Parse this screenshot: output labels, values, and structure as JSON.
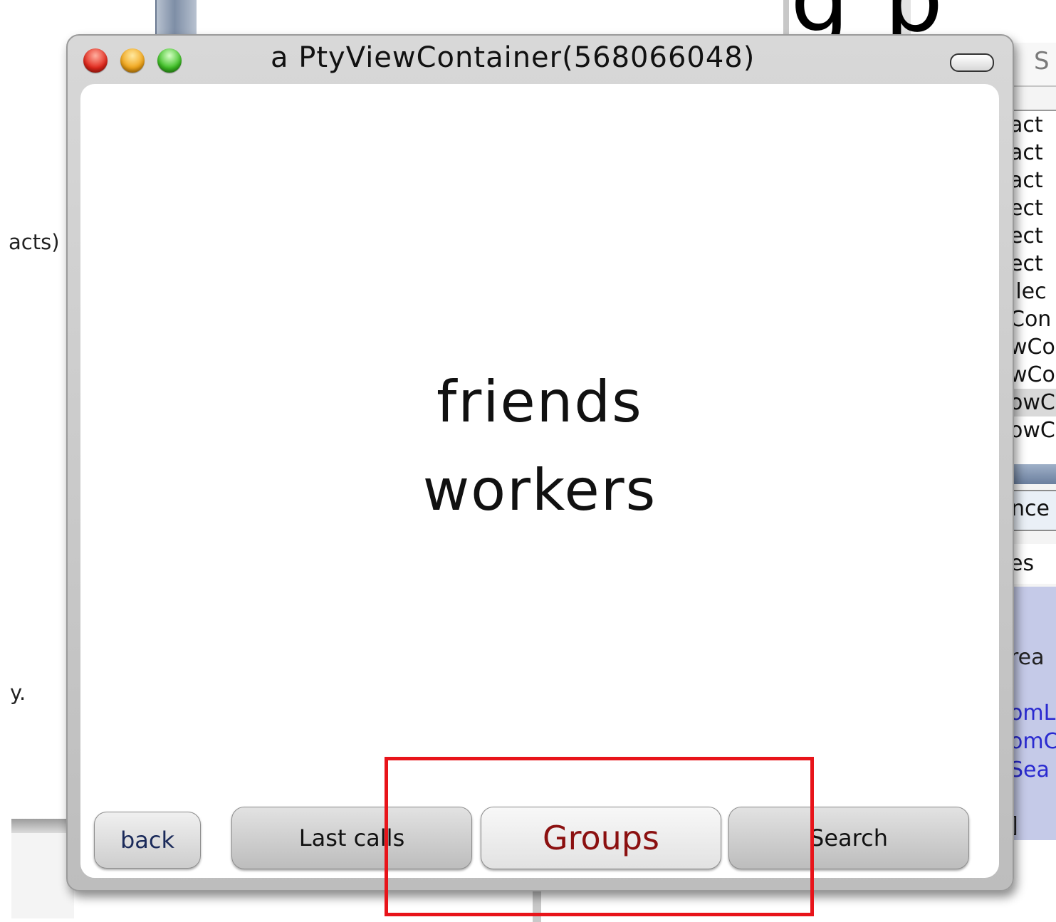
{
  "background": {
    "big_text": "g p",
    "left_fragment_1": "acts)",
    "left_fragment_2": "y.",
    "right_panel": {
      "tab_text": "S",
      "list_items": [
        "act",
        "act",
        "act",
        "ect",
        "ect",
        "ect",
        "ilec",
        "Con",
        "wCo",
        "wCo",
        "owC",
        "owC"
      ],
      "selected_index": 10,
      "field_text": "nce",
      "field2_text": "es",
      "blue_items": [
        "rea",
        "omL",
        "omC",
        "Sea",
        "]"
      ]
    }
  },
  "window": {
    "title": "a PtyViewContainer(568066048)",
    "groups": [
      "friends",
      "workers"
    ],
    "buttons": {
      "back": "back",
      "last_calls": "Last calls",
      "groups": "Groups",
      "search": "Search"
    },
    "selected_tab": "Groups"
  },
  "annotation": {
    "color": "#e8141a",
    "target": "Groups"
  }
}
